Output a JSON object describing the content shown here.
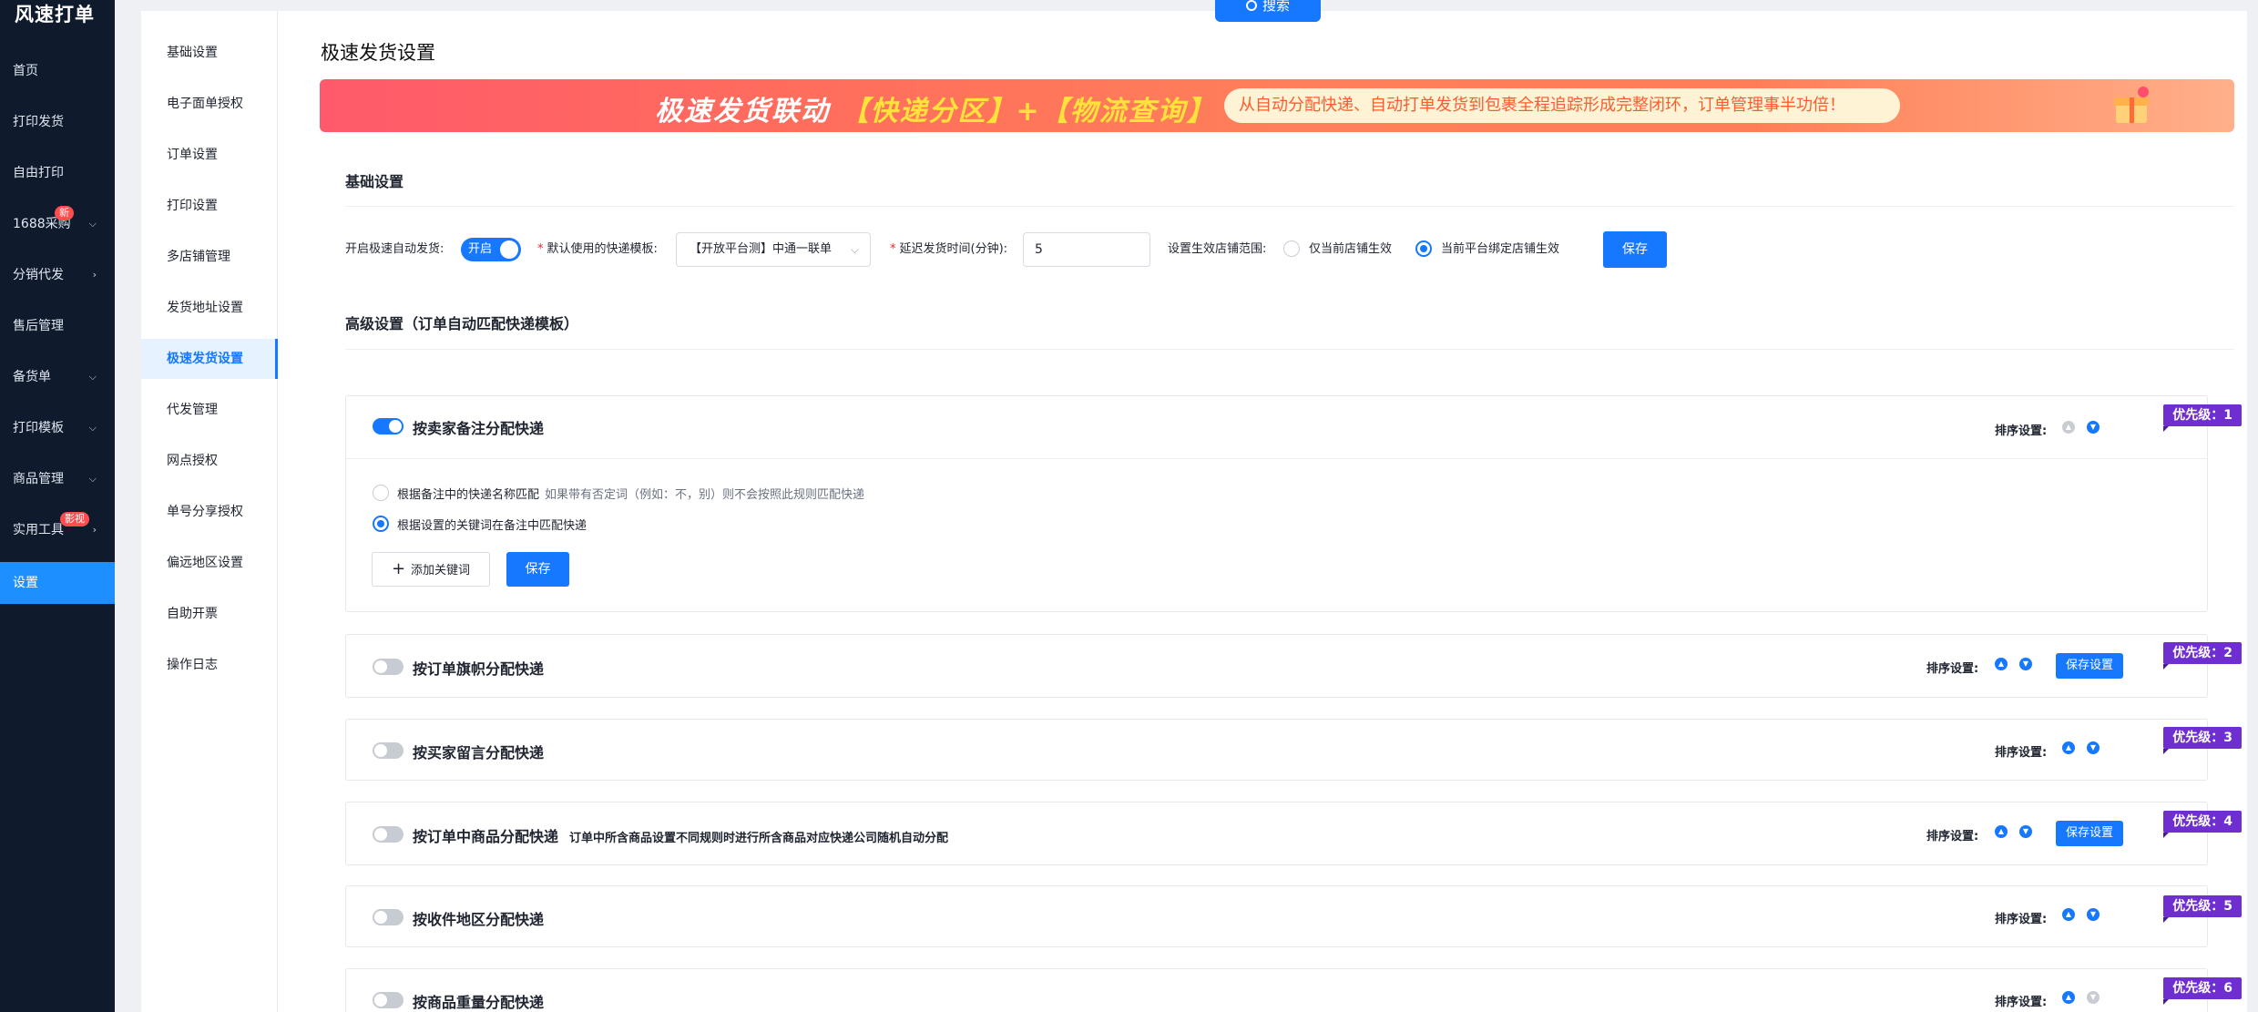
{
  "app": {
    "brand": "风速打单"
  },
  "leftnav": [
    {
      "label": "首页"
    },
    {
      "label": "打印发货"
    },
    {
      "label": "自由打印"
    },
    {
      "label": "1688采购",
      "badge": "新",
      "chevron": "chevron-down"
    },
    {
      "label": "分销代发",
      "chevron": "chevron-right"
    },
    {
      "label": "售后管理"
    },
    {
      "label": "备货单",
      "chevron": "chevron-down"
    },
    {
      "label": "打印模板",
      "chevron": "chevron-down"
    },
    {
      "label": "商品管理",
      "chevron": "chevron-down"
    },
    {
      "label": "实用工具",
      "badge": "影视",
      "chevron": "chevron-right"
    },
    {
      "label": "设置",
      "active": true
    }
  ],
  "subnav": [
    {
      "label": "基础设置"
    },
    {
      "label": "电子面单授权"
    },
    {
      "label": "订单设置"
    },
    {
      "label": "打印设置"
    },
    {
      "label": "多店铺管理"
    },
    {
      "label": "发货地址设置"
    },
    {
      "label": "极速发货设置",
      "active": true
    },
    {
      "label": "代发管理"
    },
    {
      "label": "网点授权"
    },
    {
      "label": "单号分享授权"
    },
    {
      "label": "偏远地区设置"
    },
    {
      "label": "自助开票"
    },
    {
      "label": "操作日志"
    }
  ],
  "search_tab": {
    "label": "搜索"
  },
  "page": {
    "title": "极速发货设置"
  },
  "banner": {
    "title_prefix": "极速发货联动",
    "title_highlight": "【快递分区】+【物流查询】",
    "pill": "从自动分配快递、自动打单发货到包裹全程追踪形成完整闭环，订单管理事半功倍！"
  },
  "basic": {
    "section_title": "基础设置",
    "auto_ship_label": "开启极速自动发货:",
    "auto_ship_toggle": "开启",
    "template_label": "默认使用的快递模板:",
    "template_value": "【开放平台测】中通一联单",
    "delay_label": "延迟发货时间(分钟):",
    "delay_value": "5",
    "scope_label": "设置生效店铺范围:",
    "scope_options": [
      "仅当前店铺生效",
      "当前平台绑定店铺生效"
    ],
    "scope_selected": 1,
    "save_label": "保存"
  },
  "advanced": {
    "section_title": "高级设置（订单自动匹配快递模板）",
    "sort_label": "排序设置:",
    "save_settings_label": "保存设置",
    "rules": [
      {
        "title": "按卖家备注分配快递",
        "enabled": true,
        "priority": "优先级：1",
        "options": [
          {
            "label": "根据备注中的快递名称匹配",
            "hint": "如果带有否定词（例如：不，别）则不会按照此规则匹配快递"
          },
          {
            "label": "根据设置的关键词在备注中匹配快递"
          }
        ],
        "selected_option": 1,
        "add_keyword_label": "添加关键词",
        "save_label": "保存"
      },
      {
        "title": "按订单旗帜分配快递",
        "enabled": false,
        "priority": "优先级：2"
      },
      {
        "title": "按买家留言分配快递",
        "enabled": false,
        "priority": "优先级：3"
      },
      {
        "title": "按订单中商品分配快递",
        "desc": "订单中所含商品设置不同规则时进行所含商品对应快递公司随机自动分配",
        "enabled": false,
        "priority": "优先级：4"
      },
      {
        "title": "按收件地区分配快递",
        "enabled": false,
        "priority": "优先级：5"
      },
      {
        "title": "按商品重量分配快递",
        "enabled": false,
        "priority": "优先级：6"
      }
    ]
  },
  "colors": {
    "primary": "#1677ff",
    "sidebar": "#0f1b2d",
    "priority_badge": "#6f2fd0",
    "badge_red": "#ff4d4f"
  }
}
